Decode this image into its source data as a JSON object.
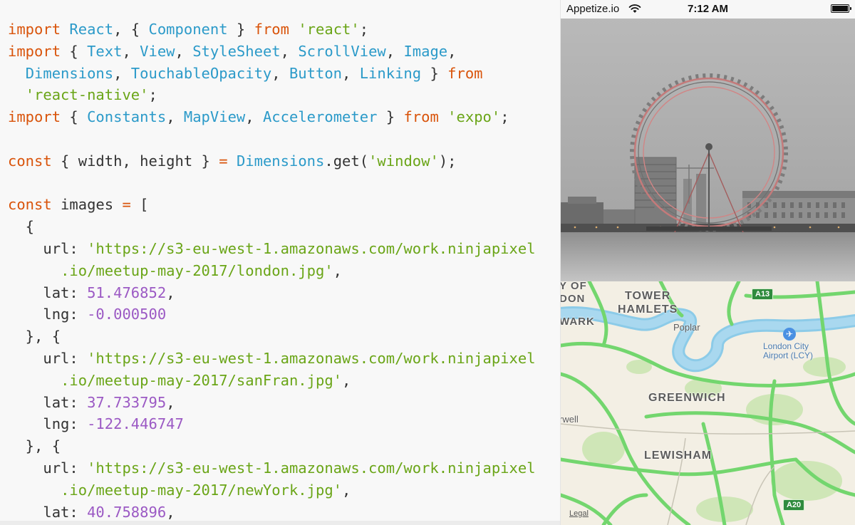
{
  "editor": {
    "lines": [
      [
        [
          "keyword",
          "import"
        ],
        [
          "plain",
          " "
        ],
        [
          "ident",
          "React"
        ],
        [
          "punct",
          ", { "
        ],
        [
          "ident",
          "Component"
        ],
        [
          "punct",
          " } "
        ],
        [
          "keyword",
          "from"
        ],
        [
          "plain",
          " "
        ],
        [
          "string",
          "'react'"
        ],
        [
          "punct",
          ";"
        ]
      ],
      [
        [
          "keyword",
          "import"
        ],
        [
          "punct",
          " { "
        ],
        [
          "ident",
          "Text"
        ],
        [
          "punct",
          ", "
        ],
        [
          "ident",
          "View"
        ],
        [
          "punct",
          ", "
        ],
        [
          "ident",
          "StyleSheet"
        ],
        [
          "punct",
          ", "
        ],
        [
          "ident",
          "ScrollView"
        ],
        [
          "punct",
          ", "
        ],
        [
          "ident",
          "Image"
        ],
        [
          "punct",
          ","
        ]
      ],
      [
        [
          "plain",
          "  "
        ],
        [
          "ident",
          "Dimensions"
        ],
        [
          "punct",
          ", "
        ],
        [
          "ident",
          "TouchableOpacity"
        ],
        [
          "punct",
          ", "
        ],
        [
          "ident",
          "Button"
        ],
        [
          "punct",
          ", "
        ],
        [
          "ident",
          "Linking"
        ],
        [
          "punct",
          " } "
        ],
        [
          "keyword",
          "from"
        ]
      ],
      [
        [
          "plain",
          "  "
        ],
        [
          "string",
          "'react-native'"
        ],
        [
          "punct",
          ";"
        ]
      ],
      [
        [
          "keyword",
          "import"
        ],
        [
          "punct",
          " { "
        ],
        [
          "ident",
          "Constants"
        ],
        [
          "punct",
          ", "
        ],
        [
          "ident",
          "MapView"
        ],
        [
          "punct",
          ", "
        ],
        [
          "ident",
          "Accelerometer"
        ],
        [
          "punct",
          " } "
        ],
        [
          "keyword",
          "from"
        ],
        [
          "plain",
          " "
        ],
        [
          "string",
          "'expo'"
        ],
        [
          "punct",
          ";"
        ]
      ],
      [],
      [
        [
          "keyword",
          "const"
        ],
        [
          "punct",
          " { "
        ],
        [
          "plain",
          "width"
        ],
        [
          "punct",
          ", "
        ],
        [
          "plain",
          "height"
        ],
        [
          "punct",
          " } "
        ],
        [
          "operator",
          "="
        ],
        [
          "plain",
          " "
        ],
        [
          "ident",
          "Dimensions"
        ],
        [
          "punct",
          "."
        ],
        [
          "plain",
          "get"
        ],
        [
          "punct",
          "("
        ],
        [
          "string",
          "'window'"
        ],
        [
          "punct",
          ");"
        ]
      ],
      [],
      [
        [
          "keyword",
          "const"
        ],
        [
          "plain",
          " images "
        ],
        [
          "operator",
          "="
        ],
        [
          "punct",
          " ["
        ]
      ],
      [
        [
          "punct",
          "  {"
        ]
      ],
      [
        [
          "plain",
          "    "
        ],
        [
          "prop",
          "url"
        ],
        [
          "punct",
          ": "
        ],
        [
          "string",
          "'https://s3-eu-west-1.amazonaws.com/work.ninjapixel"
        ]
      ],
      [
        [
          "plain",
          "      "
        ],
        [
          "string",
          ".io/meetup-may-2017/london.jpg'"
        ],
        [
          "punct",
          ","
        ]
      ],
      [
        [
          "plain",
          "    "
        ],
        [
          "prop",
          "lat"
        ],
        [
          "punct",
          ": "
        ],
        [
          "number",
          "51.476852"
        ],
        [
          "punct",
          ","
        ]
      ],
      [
        [
          "plain",
          "    "
        ],
        [
          "prop",
          "lng"
        ],
        [
          "punct",
          ": "
        ],
        [
          "number",
          "-0.000500"
        ]
      ],
      [
        [
          "punct",
          "  }, {"
        ]
      ],
      [
        [
          "plain",
          "    "
        ],
        [
          "prop",
          "url"
        ],
        [
          "punct",
          ": "
        ],
        [
          "string",
          "'https://s3-eu-west-1.amazonaws.com/work.ninjapixel"
        ]
      ],
      [
        [
          "plain",
          "      "
        ],
        [
          "string",
          ".io/meetup-may-2017/sanFran.jpg'"
        ],
        [
          "punct",
          ","
        ]
      ],
      [
        [
          "plain",
          "    "
        ],
        [
          "prop",
          "lat"
        ],
        [
          "punct",
          ": "
        ],
        [
          "number",
          "37.733795"
        ],
        [
          "punct",
          ","
        ]
      ],
      [
        [
          "plain",
          "    "
        ],
        [
          "prop",
          "lng"
        ],
        [
          "punct",
          ": "
        ],
        [
          "number",
          "-122.446747"
        ]
      ],
      [
        [
          "punct",
          "  }, {"
        ]
      ],
      [
        [
          "plain",
          "    "
        ],
        [
          "prop",
          "url"
        ],
        [
          "punct",
          ": "
        ],
        [
          "string",
          "'https://s3-eu-west-1.amazonaws.com/work.ninjapixel"
        ]
      ],
      [
        [
          "plain",
          "      "
        ],
        [
          "string",
          ".io/meetup-may-2017/newYork.jpg'"
        ],
        [
          "punct",
          ","
        ]
      ],
      [
        [
          "plain",
          "    "
        ],
        [
          "prop",
          "lat"
        ],
        [
          "punct",
          ": "
        ],
        [
          "number",
          "40.758896"
        ],
        [
          "punct",
          ","
        ]
      ]
    ]
  },
  "simulator": {
    "status_bar": {
      "carrier": "Appetize.io",
      "wifi_icon": "wifi-icon",
      "time": "7:12 AM",
      "battery_icon": "battery-icon"
    },
    "photo": {
      "description_icon": "london-eye-photo"
    },
    "map": {
      "labels": {
        "tower_hamlets_1": "TOWER",
        "tower_hamlets_2": "HAMLETS",
        "poplar": "Poplar",
        "greenwich": "GREENWICH",
        "lewisham": "LEWISHAM",
        "airport_1": "London City",
        "airport_2": "Airport (LCY)",
        "edge_top_1": "Y OF",
        "edge_top_2": "DON",
        "edge_wark": "WARK",
        "edge_rwell": "rwell"
      },
      "shields": {
        "a13": "A13",
        "a20": "A20"
      },
      "legal": "Legal",
      "airport_icon": "airport-icon"
    }
  }
}
